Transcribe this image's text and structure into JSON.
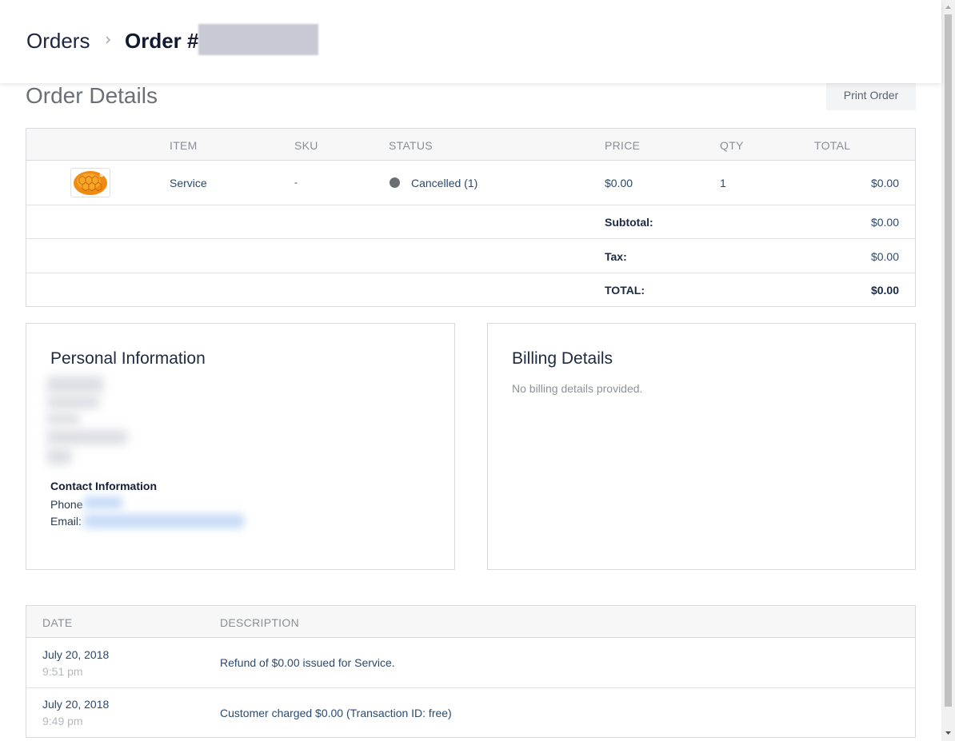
{
  "breadcrumb": {
    "orders_label": "Orders",
    "order_label": "Order #"
  },
  "page_title": "Order Details",
  "print_label": "Print Order",
  "items_table": {
    "headers": [
      "ITEM",
      "SKU",
      "STATUS",
      "PRICE",
      "QTY",
      "TOTAL"
    ],
    "rows": [
      {
        "item": "Service",
        "sku": "-",
        "status": "Cancelled (1)",
        "price": "$0.00",
        "qty": "1",
        "total": "$0.00"
      }
    ],
    "summary": {
      "subtotal_label": "Subtotal:",
      "subtotal_value": "$0.00",
      "tax_label": "Tax:",
      "tax_value": "$0.00",
      "total_label": "TOTAL:",
      "total_value": "$0.00"
    }
  },
  "personal": {
    "title": "Personal Information",
    "contact_heading": "Contact Information",
    "phone_label": "Phone",
    "email_label": "Email:"
  },
  "billing": {
    "title": "Billing Details",
    "empty_text": "No billing details provided."
  },
  "history": {
    "headers": [
      "DATE",
      "DESCRIPTION"
    ],
    "rows": [
      {
        "date": "July 20, 2018",
        "time": "9:51 pm",
        "description": "Refund of $0.00 issued for Service."
      },
      {
        "date": "July 20, 2018",
        "time": "9:49 pm",
        "description": "Customer charged $0.00 (Transaction ID: free)"
      }
    ]
  },
  "colors": {
    "status_dot": "#6c6f72",
    "link_text": "#2a4a6e",
    "muted_text": "#8d9298"
  },
  "icons": {
    "breadcrumb_separator": "chevron-right-icon",
    "product_thumbnail": "honeycomb-image"
  }
}
